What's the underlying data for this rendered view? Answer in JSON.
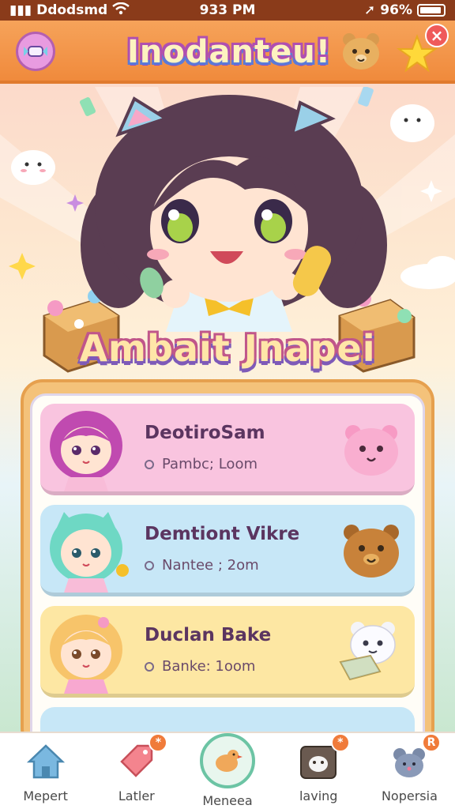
{
  "status_bar": {
    "carrier": "Ddodsmd",
    "time": "933 PM",
    "battery": "96%"
  },
  "header": {
    "title": "Inodanteu!"
  },
  "banner": {
    "title": "Ambait Jnapei"
  },
  "list": {
    "items": [
      {
        "title": "DeotiroSam",
        "subtitle": "Pambc; Loom",
        "color": "#f9c4df"
      },
      {
        "title": "Demtiont Vikre",
        "subtitle": "Nantee ; 2om",
        "color": "#c7e7f7"
      },
      {
        "title": "Duclan Bake",
        "subtitle": "Banke: 1oom",
        "color": "#fde7a3"
      }
    ]
  },
  "tabs": [
    {
      "label": "Mepert",
      "icon": "house-icon",
      "badge": ""
    },
    {
      "label": "Latler",
      "icon": "tag-icon",
      "badge": "*"
    },
    {
      "label": "Meneea",
      "icon": "chicken-icon",
      "badge": ""
    },
    {
      "label": "laving",
      "icon": "pet-tv-icon",
      "badge": "*"
    },
    {
      "label": "Nopersia",
      "icon": "mouse-toy-icon",
      "badge": "R"
    }
  ]
}
